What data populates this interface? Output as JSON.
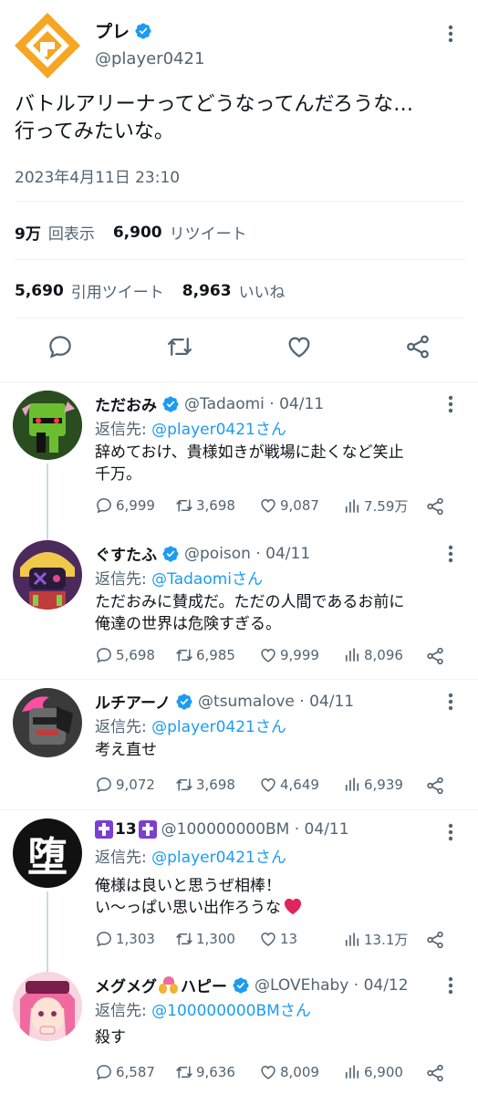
{
  "main_tweet": {
    "name": "プレ",
    "handle": "@player0421",
    "text": "バトルアリーナってどうなってんだろうな…\n行ってみたいな。",
    "timestamp": "2023年4月11日 23:10",
    "views_count": "9万",
    "views_label": "回表示",
    "retweets_count": "6,900",
    "retweets_label": "リツイート",
    "quotes_count": "5,690",
    "quotes_label": "引用ツイート",
    "likes_count": "8,963",
    "likes_label": "いいね"
  },
  "replies": [
    {
      "name": "ただおみ",
      "handle": "@Tadaomi · 04/11",
      "reply_prefix": "返信先: ",
      "reply_to": "@player0421さん",
      "text": "辞めておけ、貴様如きが戦場に赴くなど笑止\n千万。",
      "replies": "6,999",
      "retweets": "3,698",
      "likes": "9,087",
      "views": "7.59万"
    },
    {
      "name": "ぐすたふ",
      "handle": "@poison · 04/11",
      "reply_prefix": "返信先: ",
      "reply_to": "@Tadaomiさん",
      "text": "ただおみに賛成だ。ただの人間であるお前に\n俺達の世界は危険すぎる。",
      "replies": "5,698",
      "retweets": "6,985",
      "likes": "9,999",
      "views": "8,096"
    },
    {
      "name": "ルチアーノ",
      "handle": "@tsumalove · 04/11",
      "reply_prefix": "返信先: ",
      "reply_to": "@player0421さん",
      "text": "考え直せ",
      "replies": "9,072",
      "retweets": "3,698",
      "likes": "4,649",
      "views": "6,939"
    },
    {
      "name": "13",
      "handle": "@100000000BM · 04/11",
      "reply_prefix": "返信先: ",
      "reply_to": "@player0421さん",
      "text": "俺様は良いと思うぜ相棒！\nい〜っぱい思い出作ろうな",
      "replies": "1,303",
      "retweets": "1,300",
      "likes": "13",
      "views": "13.1万",
      "avatar_glyph": "堕"
    },
    {
      "name": "メグメグ",
      "name_suffix": "ハピー",
      "handle": "@LOVEhaby · 04/12",
      "reply_prefix": "返信先: ",
      "reply_to": "@100000000BMさん",
      "text": "殺す",
      "replies": "6,587",
      "retweets": "9,636",
      "likes": "8,009",
      "views": "6,900"
    }
  ],
  "colors": {
    "accent": "#1d9bf0",
    "text": "#0f1419",
    "muted": "#536471",
    "divider": "#eff3f4",
    "logo_orange": "#f5a623",
    "heart_red": "#e0245e"
  },
  "icons": {
    "verified": "verified-badge-icon",
    "more": "more-options-icon",
    "reply": "reply-icon",
    "retweet": "retweet-icon",
    "like": "heart-icon",
    "views": "views-icon",
    "share": "share-icon"
  }
}
